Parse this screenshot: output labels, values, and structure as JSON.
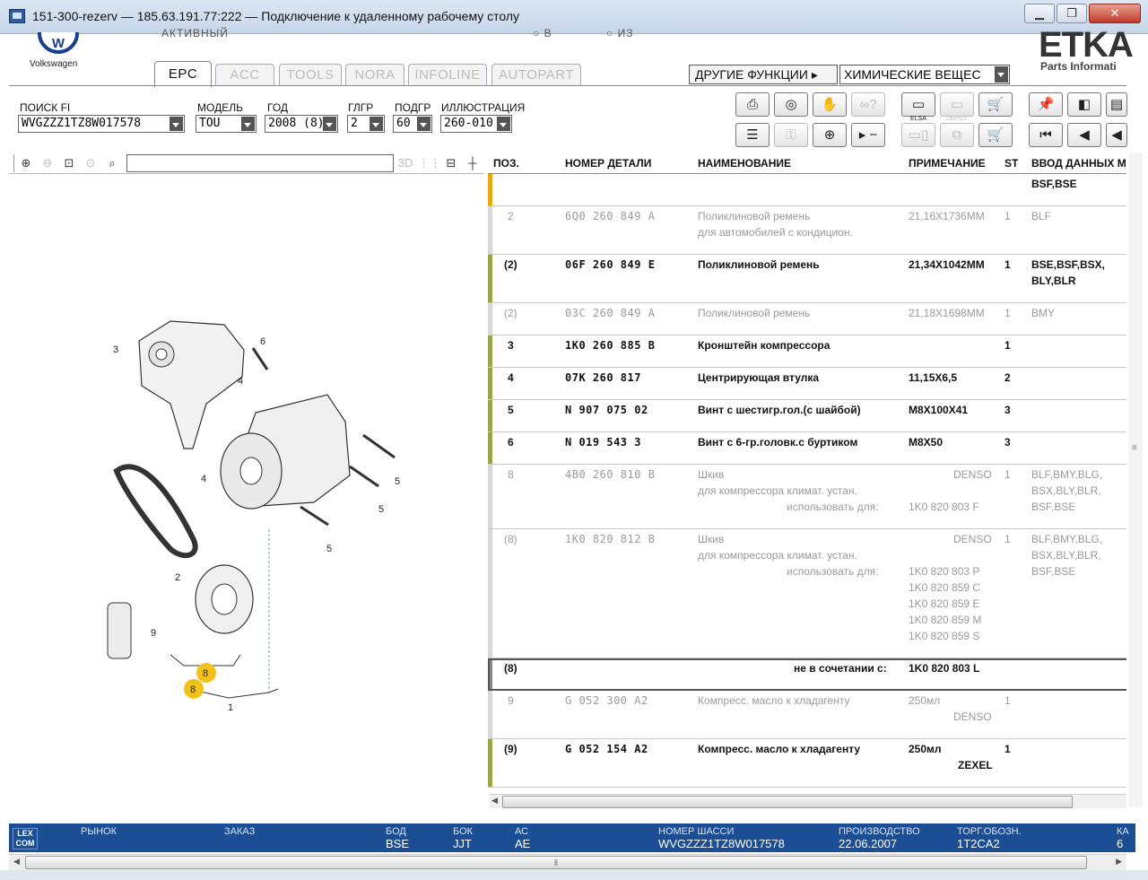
{
  "window": {
    "title": "151-300-rezerv — 185.63.191.77:222 — Подключение к удаленному рабочему столу",
    "controls": [
      "minimize",
      "restore",
      "close"
    ]
  },
  "header": {
    "brand_name": "Volkswagen",
    "cut_labels": [
      "АКТИВНЫЙ",
      "В",
      "ИЗ"
    ],
    "etka_logo": "ETKA",
    "etka_sub": "Parts Informati",
    "tabs": [
      "EPC",
      "ACC",
      "TOOLS",
      "NORA",
      "INFOLINE",
      "AUTOPART"
    ],
    "active_tab": "EPC",
    "other_functions_label": "ДРУГИЕ ФУНКЦИИ ▸",
    "other_functions_value": "ХИМИЧЕСКИЕ ВЕЩЕС"
  },
  "search": {
    "fi_label": "ПОИСК FI",
    "fi_value": "WVGZZZ1TZ8W017578",
    "model_label": "МОДЕЛЬ",
    "model_value": "TOU",
    "year_label": "ГОД",
    "year_value": "2008 (8)",
    "mg_label": "ГЛГР",
    "mg_value": "2",
    "sg_label": "ПОДГР",
    "sg_value": "60",
    "illus_label": "ИЛЛЮСТРАЦИЯ",
    "illus_value": "260-010"
  },
  "toolbar": {
    "row1": [
      "print-icon",
      "tire-icon",
      "handshake-icon",
      "glasses-icon",
      "elsa-icon",
      "depot-icon",
      "cart-arrow-icon",
      "pin-icon",
      "book-prev-icon",
      "book-icon"
    ],
    "row2": [
      "list-icon",
      "key-icon",
      "steering-icon",
      "play-minus-icon",
      "monitor-icon",
      "copy-icon",
      "cart-icon",
      "first-icon",
      "prev-icon",
      "back-icon"
    ],
    "elsa_text": "ELSA",
    "depot_text": "DEPOT"
  },
  "left_toolbar": {
    "buttons": [
      "zoom-in-icon",
      "zoom-out-icon",
      "zoom-fit-icon",
      "zoom-area-icon",
      "magnifier-icon"
    ],
    "right_buttons": [
      "3d-icon",
      "grid-icon",
      "split-icon",
      "crosshair-icon"
    ],
    "three_d": "3D"
  },
  "table": {
    "headers": {
      "pos": "ПОЗ.",
      "part": "НОМЕР ДЕТАЛИ",
      "name": "НАИМЕНОВАНИЕ",
      "note": "ПРИМЕЧАНИЕ",
      "st": "ST",
      "input": "ВВОД ДАННЫХ М"
    },
    "rows": [
      {
        "pos": "",
        "part": "",
        "name": "",
        "name2": "",
        "note": "",
        "st": "",
        "input": "BSF,BSE",
        "input2": "",
        "input3": "",
        "style": "top"
      },
      {
        "pos": "2",
        "part": "6Q0  260  849  A",
        "name": "Поликлиновой ремень",
        "name2": "для автомобилей с кондицион.",
        "note": "21,16X1736MM",
        "st": "1",
        "input": "BLF",
        "input2": "",
        "input3": "",
        "style": "grey"
      },
      {
        "pos": "(2)",
        "part": "06F  260  849  E",
        "name": "Поликлиновой ремень",
        "name2": "",
        "note": "21,34X1042MM",
        "st": "1",
        "input": "BSE,BSF,BSX,",
        "input2": "BLY,BLR",
        "input3": "",
        "style": "active"
      },
      {
        "pos": "(2)",
        "part": "03C  260  849  A",
        "name": "Поликлиновой ремень",
        "name2": "",
        "note": "21,18X1698MM",
        "st": "1",
        "input": "BMY",
        "input2": "",
        "input3": "",
        "style": "grey"
      },
      {
        "pos": "3",
        "part": "1K0  260  885  B",
        "name": "Кронштейн компрессора",
        "name2": "",
        "note": "",
        "st": "1",
        "input": "",
        "input2": "",
        "input3": "",
        "style": "active"
      },
      {
        "pos": "4",
        "part": "07K  260  817",
        "name": "Центрирующая втулка",
        "name2": "",
        "note": "11,15X6,5",
        "st": "2",
        "input": "",
        "input2": "",
        "input3": "",
        "style": "active"
      },
      {
        "pos": "5",
        "part": "N    907  075  02",
        "name": "Винт с шестигр.гол.(с шайбой)",
        "name2": "",
        "note": "M8X100X41",
        "st": "3",
        "input": "",
        "input2": "",
        "input3": "",
        "style": "active"
      },
      {
        "pos": "6",
        "part": "N    019  543  3",
        "name": "Винт с 6-гр.головк.с буртиком",
        "name2": "",
        "note": "M8X50",
        "st": "3",
        "input": "",
        "input2": "",
        "input3": "",
        "style": "active"
      },
      {
        "pos": "8",
        "part": "4B0  260  810  B",
        "name": "Шкив",
        "name2": "для компрессора климат. устан.",
        "name3": "использовать для:",
        "note": "DENSO",
        "note_lines": [
          "1K0 820 803 F"
        ],
        "st": "1",
        "input": "BLF,BMY,BLG,",
        "input2": "BSX,BLY,BLR,",
        "input3": "BSF,BSE",
        "style": "grey"
      },
      {
        "pos": "(8)",
        "part": "1K0  820  812  B",
        "name": "Шкив",
        "name2": "для компрессора климат. устан.",
        "name3": "использовать для:",
        "note": "DENSO",
        "note_lines": [
          "1K0 820 803 P",
          "1K0 820 859 C",
          "1K0 820 859 E",
          "1K0 820 859 M",
          "1K0 820 859 S"
        ],
        "st": "1",
        "input": "BLF,BMY,BLG,",
        "input2": "BSX,BLY,BLR,",
        "input3": "BSF,BSE",
        "style": "grey"
      },
      {
        "pos": "(8)",
        "part": "",
        "name": "",
        "name2": "",
        "name3": "не в сочетании с:",
        "note": "1K0 820 803 L",
        "st": "",
        "input": "",
        "input2": "",
        "input3": "",
        "style": "boxed"
      },
      {
        "pos": "9",
        "part": "G    052  300  A2",
        "name": "Компресс. масло к хладагенту",
        "name2": "",
        "note": "250мл",
        "note2": "DENSO",
        "st": "1",
        "input": "",
        "input2": "",
        "input3": "",
        "style": "grey"
      },
      {
        "pos": "(9)",
        "part": "G    052  154  A2",
        "name": "Компресс. масло к хладагенту",
        "name2": "",
        "note": "250мл",
        "note2": "ZEXEL",
        "st": "1",
        "input": "",
        "input2": "",
        "input3": "",
        "style": "active"
      }
    ]
  },
  "diagram": {
    "labels": [
      "3",
      "6",
      "4",
      "4",
      "5",
      "5",
      "5",
      "2",
      "9",
      "8",
      "8",
      "1"
    ]
  },
  "status": {
    "logo": "LEX COM",
    "market_label": "РЫНОК",
    "market_value": "",
    "order_label": "ЗАКАЗ",
    "order_value": "",
    "engine_label": "БОД",
    "engine_value": "BSE",
    "gearbox_label": "БОК",
    "gearbox_value": "JJT",
    "ac_label": "АС",
    "ac_value": "AE",
    "chassis_label": "НОМЕР ШАССИ",
    "chassis_value": "WVGZZZ1TZ8W017578",
    "production_label": "ПРОИЗВОДСТВО",
    "production_value": "22.06.2007",
    "trade_label": "ТОРГ.ОБОЗН.",
    "trade_value": "1T2CA2",
    "extra_label": "КА",
    "extra_value": "6"
  },
  "colors": {
    "status_bar": "#1c4e96",
    "active_row_bar": "#9aa44a",
    "top_row_bar": "#e6a817",
    "badge": "#f2c21a"
  }
}
